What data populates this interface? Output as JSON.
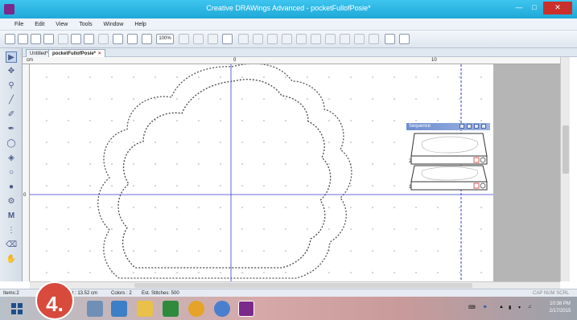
{
  "window": {
    "title": "Creative DRAWings Advanced - pocketFullofPosie*"
  },
  "menu": [
    "File",
    "Edit",
    "View",
    "Tools",
    "Window",
    "Help"
  ],
  "toolbar": {
    "zoom_value": "100%"
  },
  "tabs": [
    {
      "label": "Untitled*"
    },
    {
      "label": "pocketFullofPosie*"
    }
  ],
  "ruler": {
    "origin": "cm",
    "mark_0": "0",
    "mark_10": "10",
    "vert_mark": "0"
  },
  "sequence_panel": {
    "title": "Sequence",
    "items": [
      {
        "number": "2"
      },
      {
        "number": "1"
      }
    ]
  },
  "status": {
    "items": "Items:2",
    "height": "Height : 13.52 cm",
    "colors": "Colors : 2",
    "stitches": "Est. Stitches: 500",
    "indicators": "CAP NUM SCRL"
  },
  "taskbar": {
    "time": "10:38 PM",
    "date": "2/17/2015"
  },
  "overlay": {
    "step_label": "4."
  },
  "colors": {
    "titlebar": "#1fa8d8",
    "badge": "#d84a3c",
    "guide_line": "#3a3acc",
    "close_button": "#c9302c"
  }
}
